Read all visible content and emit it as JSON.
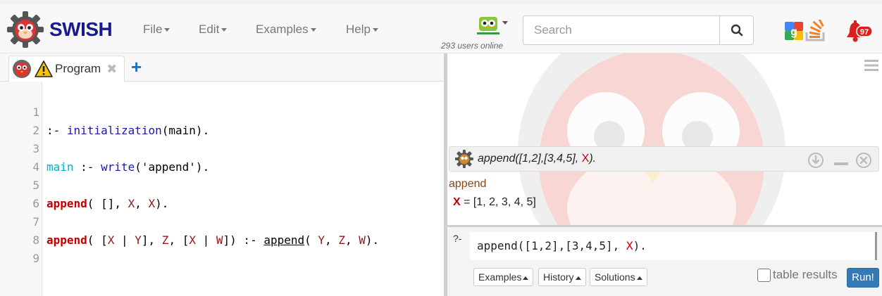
{
  "navbar": {
    "brand": "SWISH",
    "menu": [
      {
        "label": "File"
      },
      {
        "label": "Edit"
      },
      {
        "label": "Examples"
      },
      {
        "label": "Help"
      }
    ],
    "users_online": "293 users online",
    "search": {
      "placeholder": "Search",
      "value": ""
    },
    "notifications_count": "97"
  },
  "editor": {
    "tab": {
      "label": "Program"
    },
    "lines": [
      {
        "n": "1"
      },
      {
        "n": "2"
      },
      {
        "n": "3"
      },
      {
        "n": "4"
      },
      {
        "n": "5"
      },
      {
        "n": "6"
      },
      {
        "n": "7"
      },
      {
        "n": "8"
      },
      {
        "n": "9"
      }
    ],
    "code": {
      "l1_op": ":- ",
      "l1_builtin": "initialization",
      "l1_rest": "(main).",
      "l3_atom": "main",
      "l3_op": " :- ",
      "l3_builtin": "write",
      "l3_rest": "('append').",
      "l5_head": "append",
      "l5_a": "( [], ",
      "l5_v1": "X",
      "l5_b": ", ",
      "l5_v2": "X",
      "l5_c": ").",
      "l7_head": "append",
      "l7_a": "( [",
      "l7_v1": "X",
      "l7_b": " | ",
      "l7_v2": "Y",
      "l7_c": "], ",
      "l7_v3": "Z",
      "l7_d": ", [",
      "l7_v4": "X",
      "l7_e": " | ",
      "l7_v5": "W",
      "l7_f": "]) :- ",
      "l7_goal": "append",
      "l7_g": "( ",
      "l7_v6": "Y",
      "l7_h": ", ",
      "l7_v7": "Z",
      "l7_i": ", ",
      "l7_v8": "W",
      "l7_j": ")."
    }
  },
  "answer": {
    "query_text": "append([1,2],[3,4,5], ",
    "query_var": "X",
    "query_end": ").",
    "output": "append",
    "binding_var": "X",
    "binding_value": " = [1, 2, 3, 4, 5]"
  },
  "query": {
    "prompt": "?-",
    "text": "append([1,2],[3,4,5], ",
    "var": "X",
    "end": ").",
    "buttons": {
      "examples": "Examples",
      "history": "History",
      "solutions": "Solutions"
    },
    "table_results": "table results",
    "run": "Run!"
  },
  "colors": {
    "accent": "#337ab7",
    "variable": "#c40000",
    "builtin": "#1a1aa6",
    "atom": "#00b0d0"
  },
  "icons": [
    "swish-logo-icon",
    "owl-icon",
    "search-icon",
    "google-icon",
    "stackoverflow-icon",
    "bell-icon",
    "warning-icon",
    "plus-icon",
    "hamburger-icon",
    "download-icon",
    "minimize-icon",
    "close-icon"
  ]
}
